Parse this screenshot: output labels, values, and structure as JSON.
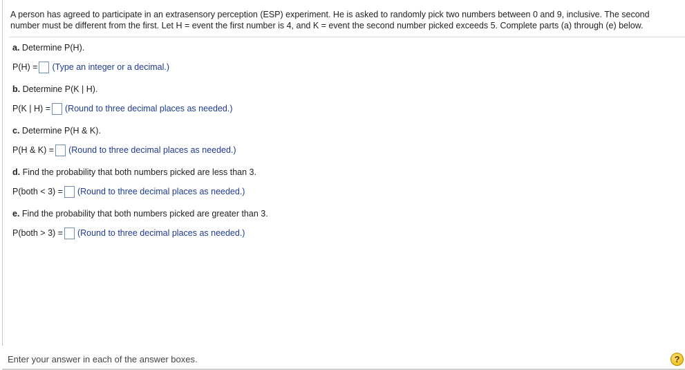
{
  "intro": "A person has agreed to participate in an extrasensory perception (ESP) experiment. He is asked to randomly pick two numbers between 0 and 9, inclusive. The second number must be different from the first. Let H = event the first number is 4, and K = event the second number picked exceeds 5. Complete parts (a) through (e) below.",
  "parts": [
    {
      "letter": "a.",
      "question": "Determine P(H).",
      "answer_label": "P(H) =",
      "hint": "(Type an integer or a decimal.)"
    },
    {
      "letter": "b.",
      "question": "Determine P(K | H).",
      "answer_label": "P(K | H) =",
      "hint": "(Round to three decimal places as needed.)"
    },
    {
      "letter": "c.",
      "question": "Determine P(H & K).",
      "answer_label": "P(H & K) =",
      "hint": "(Round to three decimal places as needed.)"
    },
    {
      "letter": "d.",
      "question": "Find the probability that both numbers picked are less than 3.",
      "answer_label": "P(both < 3) =",
      "hint": "(Round to three decimal places as needed.)"
    },
    {
      "letter": "e.",
      "question": "Find the probability that both numbers picked are greater than 3.",
      "answer_label": "P(both > 3) =",
      "hint": "(Round to three decimal places as needed.)"
    }
  ],
  "footer": {
    "instruction": "Enter your answer in each of the answer boxes.",
    "help_label": "?"
  }
}
